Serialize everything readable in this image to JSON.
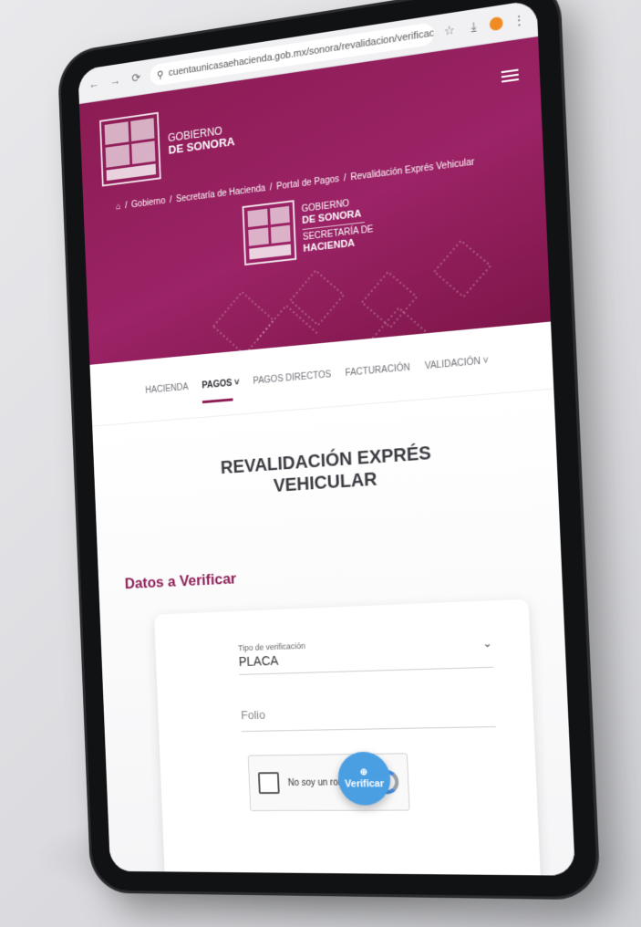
{
  "browser": {
    "url": "cuentaunicasaehacienda.gob.mx/sonora/revalidacion/verificacion",
    "nav_icons": [
      "back-icon",
      "forward-icon",
      "reload-icon",
      "site-info-icon"
    ],
    "right_icons": [
      "star-icon",
      "download-icon",
      "profile-icon",
      "menu-icon"
    ]
  },
  "header": {
    "gov_line1": "GOBIERNO",
    "gov_line2": "DE SONORA",
    "breadcrumb": [
      "Gobierno",
      "Secretaría de Hacienda",
      "Portal de Pagos",
      "Revalidación Exprés Vehicular"
    ],
    "center_logo": {
      "line1": "GOBIERNO",
      "line2": "DE SONORA",
      "line3": "SECRETARÍA DE",
      "line4": "HACIENDA"
    },
    "colors": {
      "primary": "#8c1c54",
      "secondary": "#9b2366"
    }
  },
  "nav": {
    "items": [
      {
        "label": "HACIENDA"
      },
      {
        "label": "PAGOS ˅"
      },
      {
        "label": "PAGOS DIRECTOS"
      },
      {
        "label": "FACTURACIÓN"
      },
      {
        "label": "VALIDACIÓN ˅"
      }
    ],
    "active": "PAGOS ˅"
  },
  "main": {
    "title_line1": "REVALIDACIÓN EXPRÉS",
    "title_line2": "VEHICULAR",
    "section": "Datos a Verificar",
    "form": {
      "tipo_label": "Tipo de verificación",
      "tipo_value": "PLACA",
      "folio_placeholder": "Folio",
      "captcha_label": "No soy un robot",
      "verify_label": "Verificar"
    },
    "accent": "#4a9fe3"
  }
}
